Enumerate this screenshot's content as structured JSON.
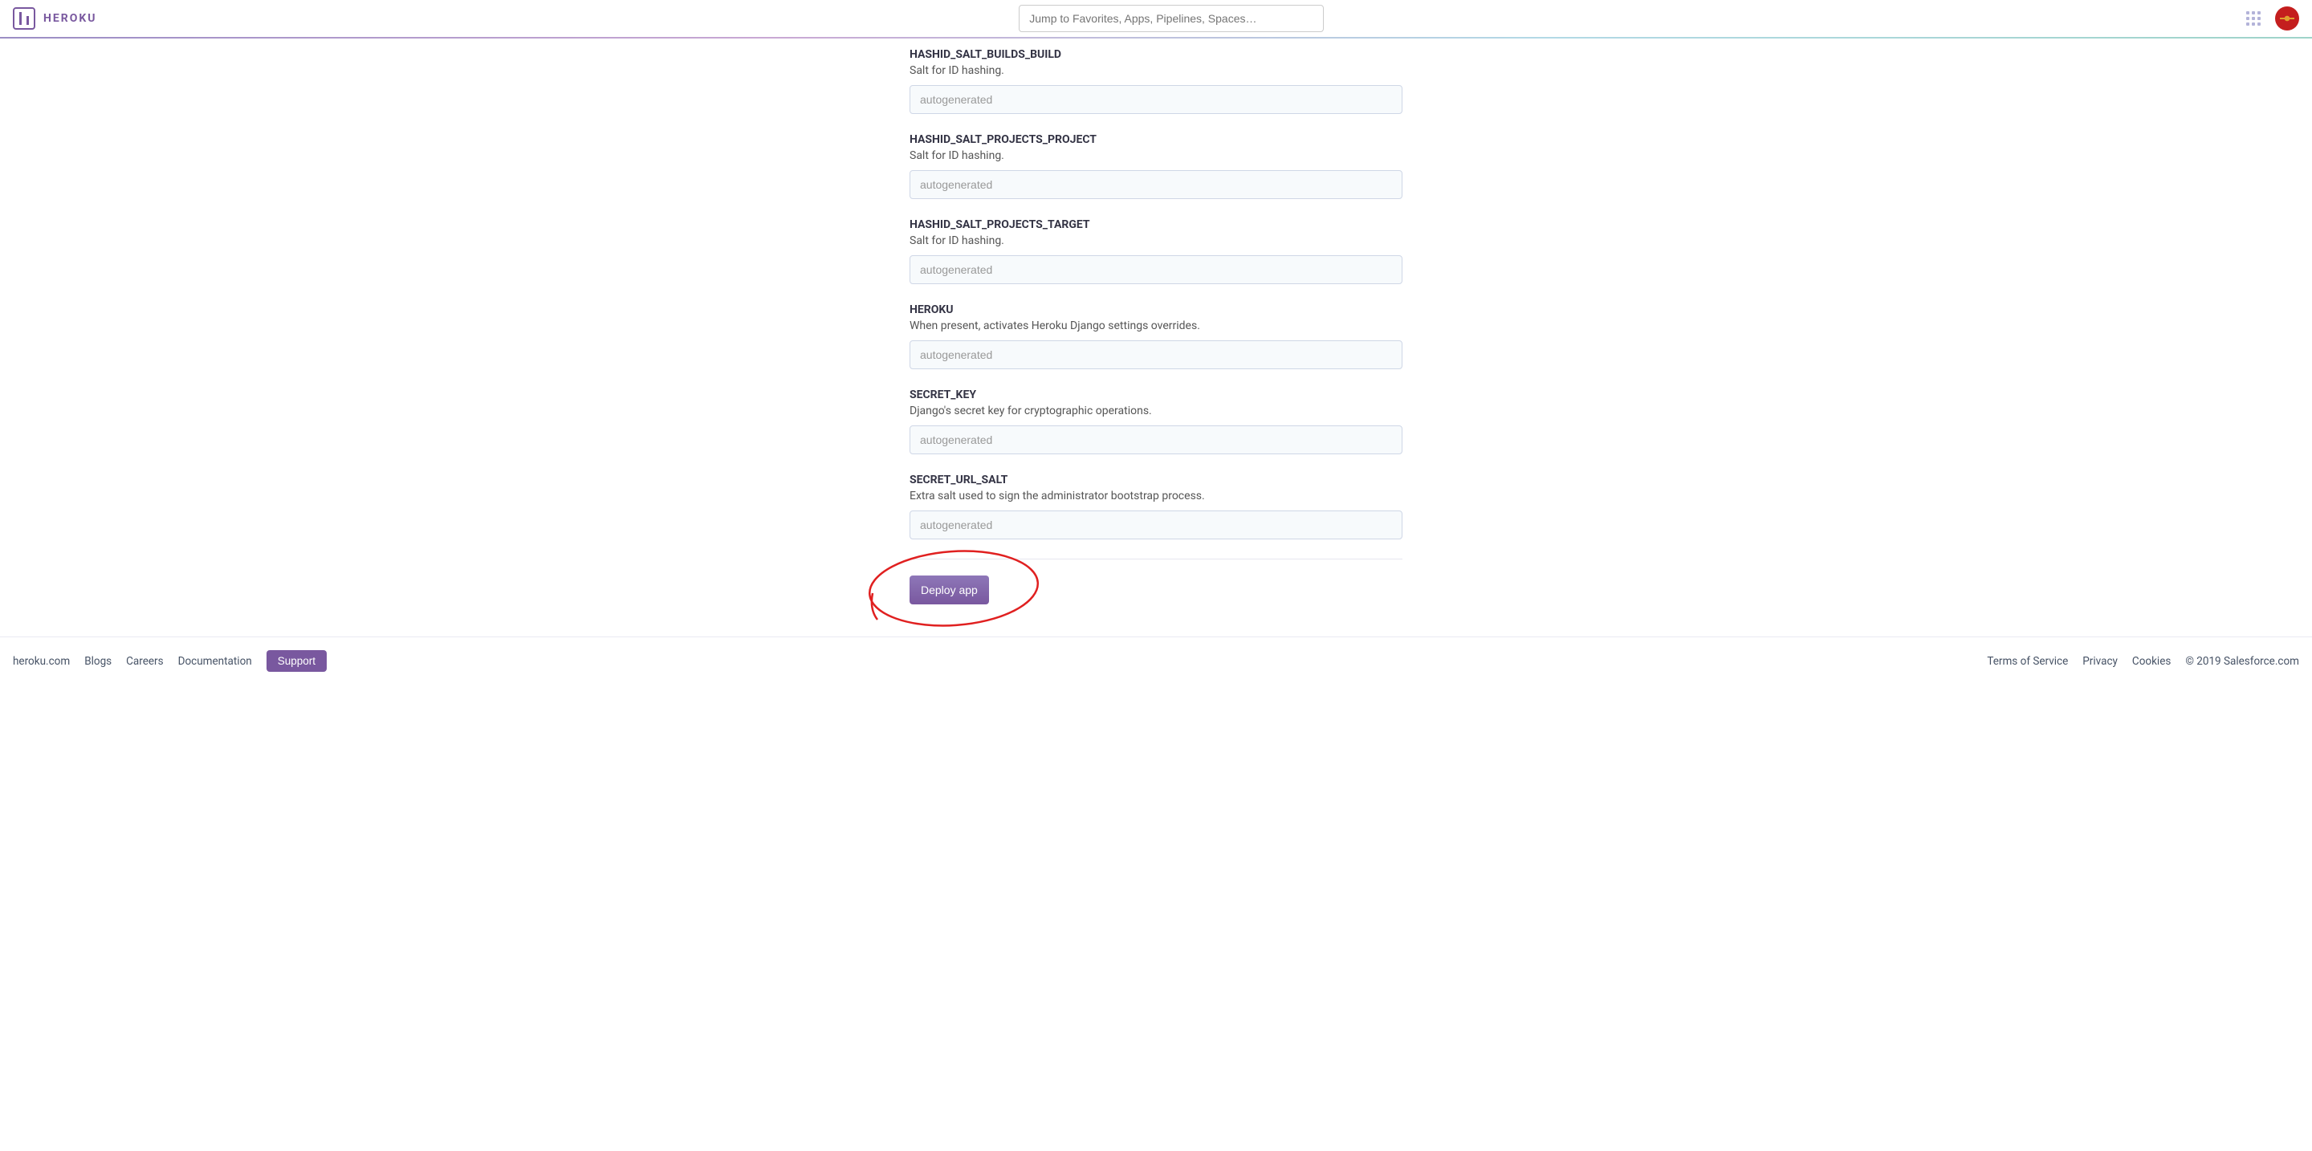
{
  "header": {
    "brand": "HEROKU",
    "search_placeholder": "Jump to Favorites, Apps, Pipelines, Spaces…"
  },
  "config_vars": [
    {
      "name": "HASHID_SALT_BUILDS_BUILD",
      "description": "Salt for ID hashing.",
      "placeholder": "autogenerated"
    },
    {
      "name": "HASHID_SALT_PROJECTS_PROJECT",
      "description": "Salt for ID hashing.",
      "placeholder": "autogenerated"
    },
    {
      "name": "HASHID_SALT_PROJECTS_TARGET",
      "description": "Salt for ID hashing.",
      "placeholder": "autogenerated"
    },
    {
      "name": "HEROKU",
      "description": "When present, activates Heroku Django settings overrides.",
      "placeholder": "autogenerated"
    },
    {
      "name": "SECRET_KEY",
      "description": "Django's secret key for cryptographic operations.",
      "placeholder": "autogenerated"
    },
    {
      "name": "SECRET_URL_SALT",
      "description": "Extra salt used to sign the administrator bootstrap process.",
      "placeholder": "autogenerated"
    }
  ],
  "deploy": {
    "button_label": "Deploy app"
  },
  "footer": {
    "links_left": {
      "heroku": "heroku.com",
      "blogs": "Blogs",
      "careers": "Careers",
      "documentation": "Documentation",
      "support": "Support"
    },
    "links_right": {
      "terms": "Terms of Service",
      "privacy": "Privacy",
      "cookies": "Cookies"
    },
    "copyright": "© 2019 Salesforce.com"
  }
}
